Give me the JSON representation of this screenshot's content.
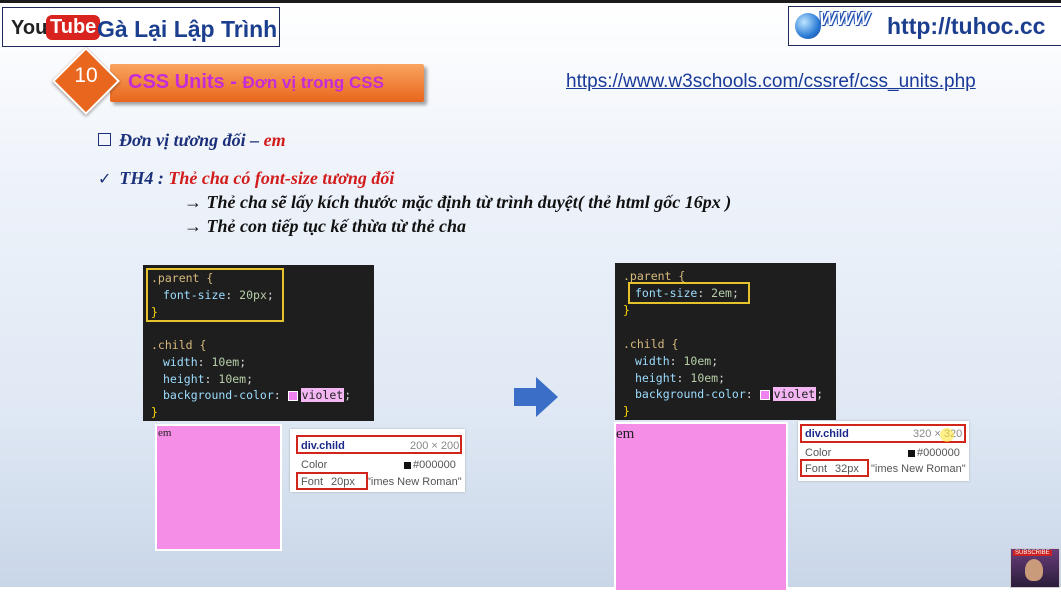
{
  "header": {
    "youtube_you": "You",
    "youtube_tube": "Tube",
    "channel_name": "Gà Lại Lập Trình",
    "site_www": "WWW",
    "site_url": "http://tuhoc.cc"
  },
  "lesson": {
    "number": "10",
    "title_main": "CSS Units - ",
    "title_sub": "Đơn vị trong CSS",
    "reference_url": "https://www.w3schools.com/cssref/css_units.php"
  },
  "content": {
    "bullet_prefix": "Đơn vị tương đối – ",
    "bullet_unit": "em",
    "check_mark": "✓",
    "case_label": "TH4 : ",
    "case_text": "Thẻ cha có font-size tương đối",
    "line_parent": "→ Thẻ cha sẽ lấy kích thước mặc định từ trình duyệt( thẻ html gốc 16px )",
    "line_child": "→ Thẻ con tiếp tục kế thừa từ thẻ cha"
  },
  "left_example": {
    "code": {
      "parent_selector": ".parent {",
      "parent_prop": "font-size",
      "parent_value": "20px",
      "close": "}",
      "child_selector": ".child {",
      "width_prop": "width",
      "width_value": "10em",
      "height_prop": "height",
      "height_value": "10em",
      "bg_prop": "background-color",
      "bg_value": "violet"
    },
    "box_text": "em",
    "tooltip": {
      "selector": "div.child",
      "size": "200 × 200",
      "color_label": "Color",
      "color_value": "#000000",
      "font_label": "Font",
      "font_size": "20px",
      "font_family": "\"imes New Roman\""
    }
  },
  "right_example": {
    "code": {
      "parent_selector": ".parent {",
      "parent_prop": "font-size",
      "parent_value": "2em",
      "close": "}",
      "child_selector": ".child {",
      "width_prop": "width",
      "width_value": "10em",
      "height_prop": "height",
      "height_value": "10em",
      "bg_prop": "background-color",
      "bg_value": "violet"
    },
    "box_text": "em",
    "tooltip": {
      "selector": "div.child",
      "size_a": "320 ",
      "size_b": "× 320",
      "color_label": "Color",
      "color_value": "#000000",
      "font_label": "Font",
      "font_size": "32px",
      "font_family": "\"imes New Roman\""
    }
  },
  "watermark": {
    "subscribe": "SUBSCRIBE"
  },
  "colors": {
    "accent_orange": "#e8661d",
    "title_magenta": "#c52bd6",
    "violet": "#ee82ee",
    "highlight_red": "#d1251c",
    "highlight_yellow": "#e6c32a"
  }
}
